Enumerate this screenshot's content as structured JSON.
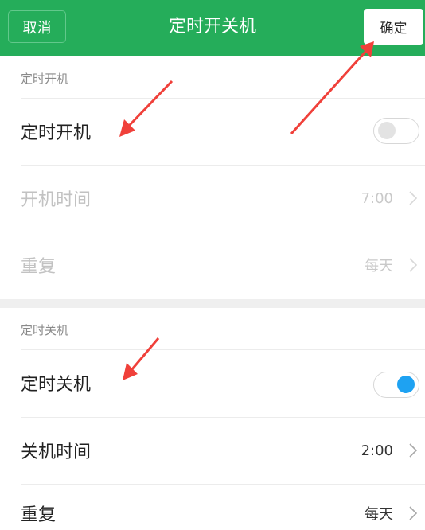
{
  "header": {
    "cancel_label": "取消",
    "title": "定时开关机",
    "confirm_label": "确定",
    "background_color": "#25ad5a"
  },
  "power_on": {
    "section_title": "定时开机",
    "toggle_label": "定时开机",
    "toggle_state": "off",
    "time_label": "开机时间",
    "time_value": "7:00",
    "repeat_label": "重复",
    "repeat_value": "每天",
    "enabled": false
  },
  "power_off": {
    "section_title": "定时关机",
    "toggle_label": "定时关机",
    "toggle_state": "on",
    "time_label": "关机时间",
    "time_value": "2:00",
    "repeat_label": "重复",
    "repeat_value": "每天",
    "enabled": true
  },
  "icons": {
    "row_chevron": "chevron-right-icon",
    "annotation": "red-arrow-icon"
  },
  "colors": {
    "toggle_on": "#1ea2f2",
    "annotation_arrow": "#f0403a"
  }
}
